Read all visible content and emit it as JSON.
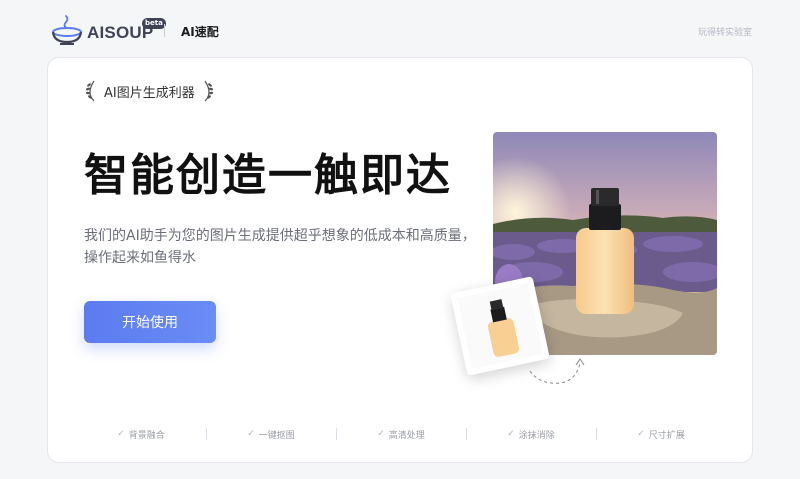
{
  "header": {
    "brand": "AISOUP",
    "beta": "beta",
    "product": "AI速配",
    "lab_link": "玩得转实验室"
  },
  "hero": {
    "badge": "AI图片生成利器",
    "headline": "智能创造一触即达",
    "description": "我们的AI助手为您的图片生成提供超乎想象的低成本和高质量，操作起来如鱼得水",
    "cta_label": "开始使用"
  },
  "features": [
    {
      "label": "背景融合",
      "icon": "check-icon"
    },
    {
      "label": "一键抠图",
      "icon": "check-icon"
    },
    {
      "label": "高清处理",
      "icon": "check-icon"
    },
    {
      "label": "涂抹消除",
      "icon": "check-icon"
    },
    {
      "label": "尺寸扩展",
      "icon": "check-icon"
    }
  ],
  "colors": {
    "accent": "#5b7bf0",
    "brand_dark": "#3f4355"
  }
}
